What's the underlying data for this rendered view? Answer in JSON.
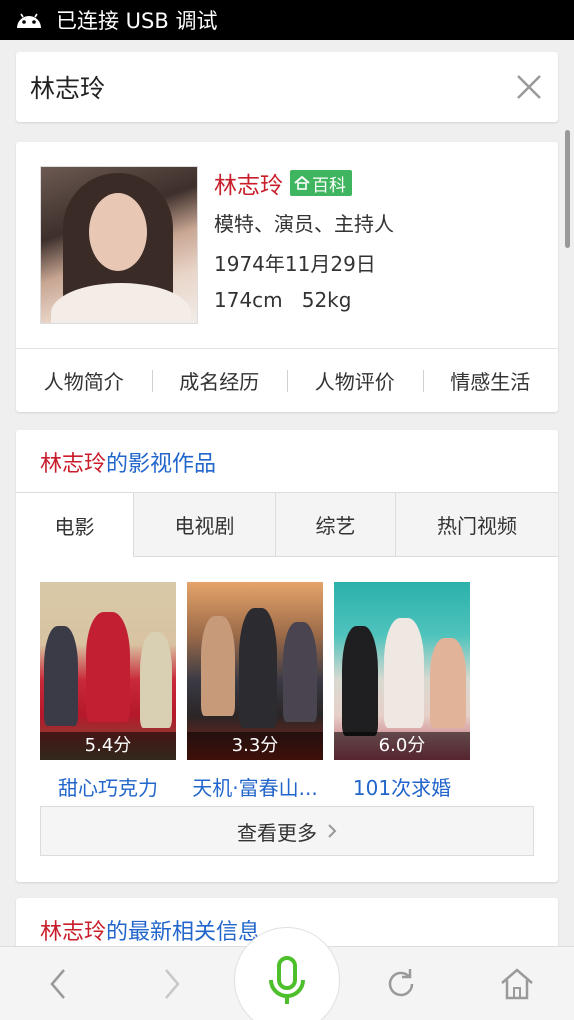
{
  "status_bar": {
    "text": "已连接 USB 调试",
    "icon": "android-icon"
  },
  "search": {
    "query": "林志玲",
    "close_icon": "close-icon"
  },
  "profile": {
    "name": "林志玲",
    "badge": "百科",
    "occupation": "模特、演员、主持人",
    "birthday": "1974年11月29日",
    "height_weight": "174cm   52kg",
    "tabs": [
      "人物简介",
      "成名经历",
      "人物评价",
      "情感生活"
    ]
  },
  "works": {
    "title_name": "林志玲",
    "title_suffix": "的影视作品",
    "tabs": [
      "电影",
      "电视剧",
      "综艺",
      "热门视频"
    ],
    "active_tab": "电影",
    "movies": [
      {
        "title": "甜心巧克力",
        "rating": "5.4分"
      },
      {
        "title": "天机·富春山...",
        "rating": "3.3分"
      },
      {
        "title": "101次求婚",
        "rating": "6.0分"
      }
    ],
    "more_label": "查看更多"
  },
  "news": {
    "title_name": "林志玲",
    "title_suffix": "的最新相关信息"
  },
  "colors": {
    "accent_red": "#c81d2a",
    "link_blue": "#2266cc",
    "badge_green": "#3fb55f",
    "mic_green": "#4cbf2a"
  }
}
